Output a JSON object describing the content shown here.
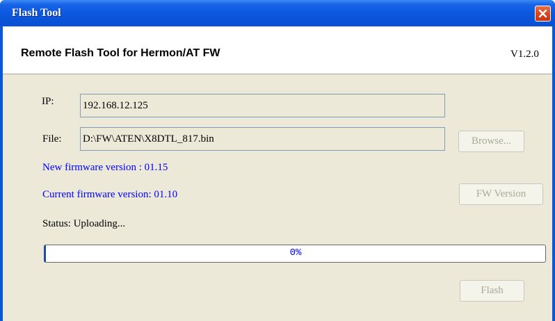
{
  "window": {
    "title": "Flash Tool",
    "colors": {
      "titlebar": "#0a56dc",
      "client": "#ece9d8",
      "close": "#d9461f",
      "link_text": "#0000ff"
    }
  },
  "header": {
    "title": "Remote Flash Tool for Hermon/AT FW",
    "version": "V1.2.0"
  },
  "form": {
    "ip_label": "IP:",
    "ip_value": "192.168.12.125",
    "file_label": "File:",
    "file_value": "D:\\FW\\ATEN\\X8DTL_817.bin",
    "browse_label": "Browse...",
    "new_fw_text": "New firmware version : 01.15",
    "current_fw_text": "Current firmware version: 01.10",
    "fw_version_label": "FW Version",
    "status_text": "Status: Uploading..."
  },
  "progress": {
    "value": 0,
    "text": "0%"
  },
  "footer": {
    "flash_label": "Flash"
  },
  "icons": {
    "close": "close-icon"
  }
}
